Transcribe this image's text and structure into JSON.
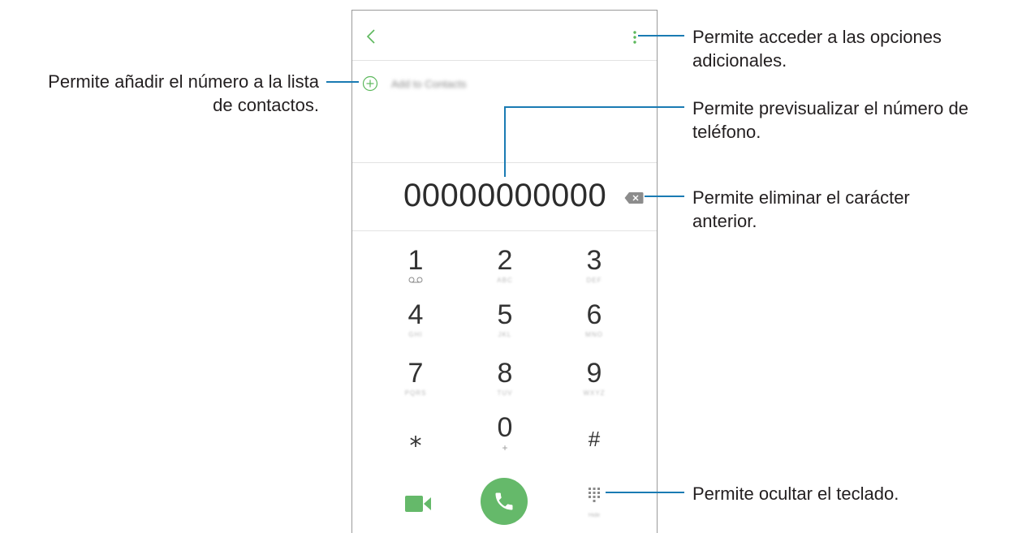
{
  "dialer": {
    "add_to_contacts_label": "Add to Contacts",
    "phone_number": "00000000000",
    "keys": [
      {
        "digit": "1",
        "letters": ""
      },
      {
        "digit": "2",
        "letters": "ABC"
      },
      {
        "digit": "3",
        "letters": "DEF"
      },
      {
        "digit": "4",
        "letters": "GHI"
      },
      {
        "digit": "5",
        "letters": "JKL"
      },
      {
        "digit": "6",
        "letters": "MNO"
      },
      {
        "digit": "7",
        "letters": "PQRS"
      },
      {
        "digit": "8",
        "letters": "TUV"
      },
      {
        "digit": "9",
        "letters": "WXYZ"
      },
      {
        "digit": "⁎",
        "letters": ""
      },
      {
        "digit": "0",
        "letters": "+"
      },
      {
        "digit": "#",
        "letters": ""
      }
    ],
    "hide_label": "Hide",
    "accent_color": "#65b96a"
  },
  "callouts": {
    "add_contact": {
      "line1": "Permite añadir el número a la lista",
      "line2": "de contactos."
    },
    "more_options": {
      "line1": "Permite acceder a las opciones",
      "line2": "adicionales."
    },
    "preview_number": {
      "line1": "Permite previsualizar el número de",
      "line2": "teléfono."
    },
    "delete_char": {
      "line1": "Permite eliminar el carácter",
      "line2": "anterior."
    },
    "hide_keypad": {
      "line1": "Permite ocultar el teclado."
    }
  },
  "leader_color": "#1a7bb3"
}
